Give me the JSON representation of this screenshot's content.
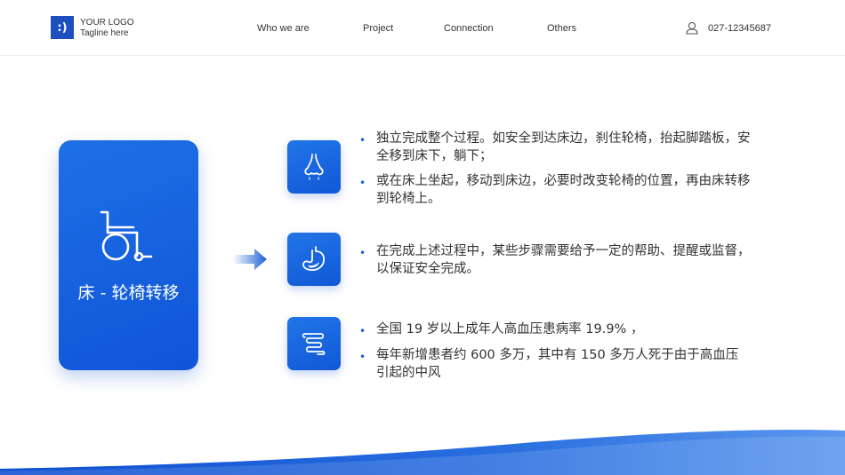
{
  "header": {
    "logo_mark": ":)",
    "logo_line1": "YOUR LOGO",
    "logo_line2": "Tagline here",
    "nav": [
      "Who we are",
      "Project",
      "Connection",
      "Others"
    ],
    "phone": "027-12345687",
    "phone_icon": "user-icon"
  },
  "card": {
    "icon": "wheelchair-icon",
    "title": "床 - 轮椅转移"
  },
  "rows": [
    {
      "icon": "nose-icon",
      "bullets": [
        "独立完成整个过程。如安全到达床边，刹住轮椅，抬起脚踏板，安全移到床下，躺下；",
        "或在床上坐起，移动到床边，必要时改变轮椅的位置，再由床转移到轮椅上。"
      ]
    },
    {
      "icon": "stomach-icon",
      "bullets": [
        "在完成上述过程中，某些步骤需要给予一定的帮助、提醒或监督，以保证安全完成。"
      ]
    },
    {
      "icon": "intestine-icon",
      "bullets": [
        "全国 19 岁以上成年人高血压患病率 19.9% ，",
        "每年新增患者约 600 多万，其中有 150 多万人死于由于高血压引起的中风"
      ]
    }
  ],
  "colors": {
    "accent": "#1d5fd6",
    "card": "#1565e0"
  }
}
